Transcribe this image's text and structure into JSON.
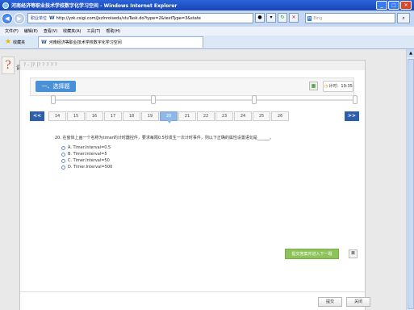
{
  "browser": {
    "title": "河南经济等职业技术学校数字化学习空间 - Windows Internet Explorer",
    "address": {
      "tag": "职业单位",
      "url": "http://yzk.csigi.com/JxzInroisedu/stuTask.do?type=2&textType=3&state"
    },
    "search": {
      "engine": "Bing",
      "placeholder": "Bing"
    },
    "menu": [
      "文件(F)",
      "编辑(E)",
      "查看(V)",
      "收藏夹(A)",
      "工具(T)",
      "帮助(H)"
    ],
    "favorites_label": "收藏夹",
    "tab_title": "河南经济等职业技术学校数字化学习空间"
  },
  "page": {
    "side_text": "课",
    "dialog_top": "? - |? |? ? ? ? ?",
    "section_title": "一、选择题",
    "timer": {
      "label": "计时：",
      "value": "19:35"
    },
    "prev": "<<",
    "next": ">>",
    "question_numbers": [
      "14",
      "15",
      "16",
      "17",
      "18",
      "19",
      "20",
      "21",
      "22",
      "23",
      "24",
      "25",
      "26"
    ],
    "active_question": "20",
    "question_text": "20. 在窗体上画一个名称为timer的计时器控件，要求每隔0.5秒发生一次计时事件，则以下正确的属性设置语句是______。",
    "options": [
      "A. Timer.Interval=0.5",
      "B. Timer.Interval=5",
      "C. Timer.Interval=50",
      "D. Timer.Interval=500"
    ],
    "submit_label": "提交答案并进入下一题",
    "small_btn": "目",
    "submit_exam": "提交",
    "close": "关闭"
  }
}
